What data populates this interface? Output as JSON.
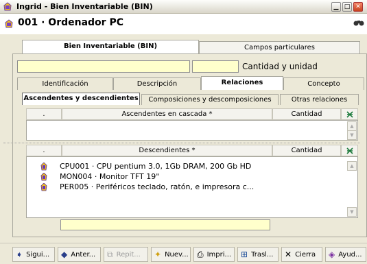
{
  "window": {
    "title": "Ingrid - Bien Inventariable (BIN)"
  },
  "header": {
    "record_title": "001 · Ordenador PC"
  },
  "main_tabs": [
    {
      "label": "Bien Inventariable (BIN)"
    },
    {
      "label": "Campos particulares"
    }
  ],
  "quantity_label": "Cantidad y unidad",
  "section_tabs": [
    {
      "label": "Identificación"
    },
    {
      "label": "Descripción"
    },
    {
      "label": "Relaciones"
    },
    {
      "label": "Concepto"
    }
  ],
  "sub_tabs": [
    {
      "label": "Ascendentes y descendientes"
    },
    {
      "label": "Composiciones y descomposiciones"
    },
    {
      "label": "Otras relaciones"
    }
  ],
  "ascendentes": {
    "col_dot": ".",
    "col_main": "Ascendentes en cascada *",
    "col_qty": "Cantidad"
  },
  "descendientes": {
    "col_dot": ".",
    "col_main": "Descendientes *",
    "col_qty": "Cantidad",
    "rows": [
      {
        "text": "CPU001 · CPU pentium 3.0, 1Gb DRAM, 200 Gb HD"
      },
      {
        "text": "MON004 · Monitor TFT 19\""
      },
      {
        "text": "PER005 · Periféricos teclado, ratón, e impresora c..."
      }
    ]
  },
  "toolbar": [
    {
      "label": "Sigui...",
      "icon": "arrow-right-icon"
    },
    {
      "label": "Anter...",
      "icon": "arrow-left-icon"
    },
    {
      "label": "Repit...",
      "icon": "repeat-icon",
      "disabled": true
    },
    {
      "label": "Nuev...",
      "icon": "new-icon"
    },
    {
      "label": "Impri...",
      "icon": "printer-icon"
    },
    {
      "label": "Trasl...",
      "icon": "transfer-icon"
    },
    {
      "label": "Cierra",
      "icon": "close-x-icon"
    },
    {
      "label": "Ayud...",
      "icon": "help-book-icon"
    }
  ],
  "colors": {
    "field_bg": "#ffffcc",
    "window_bg": "#ece9d8"
  }
}
